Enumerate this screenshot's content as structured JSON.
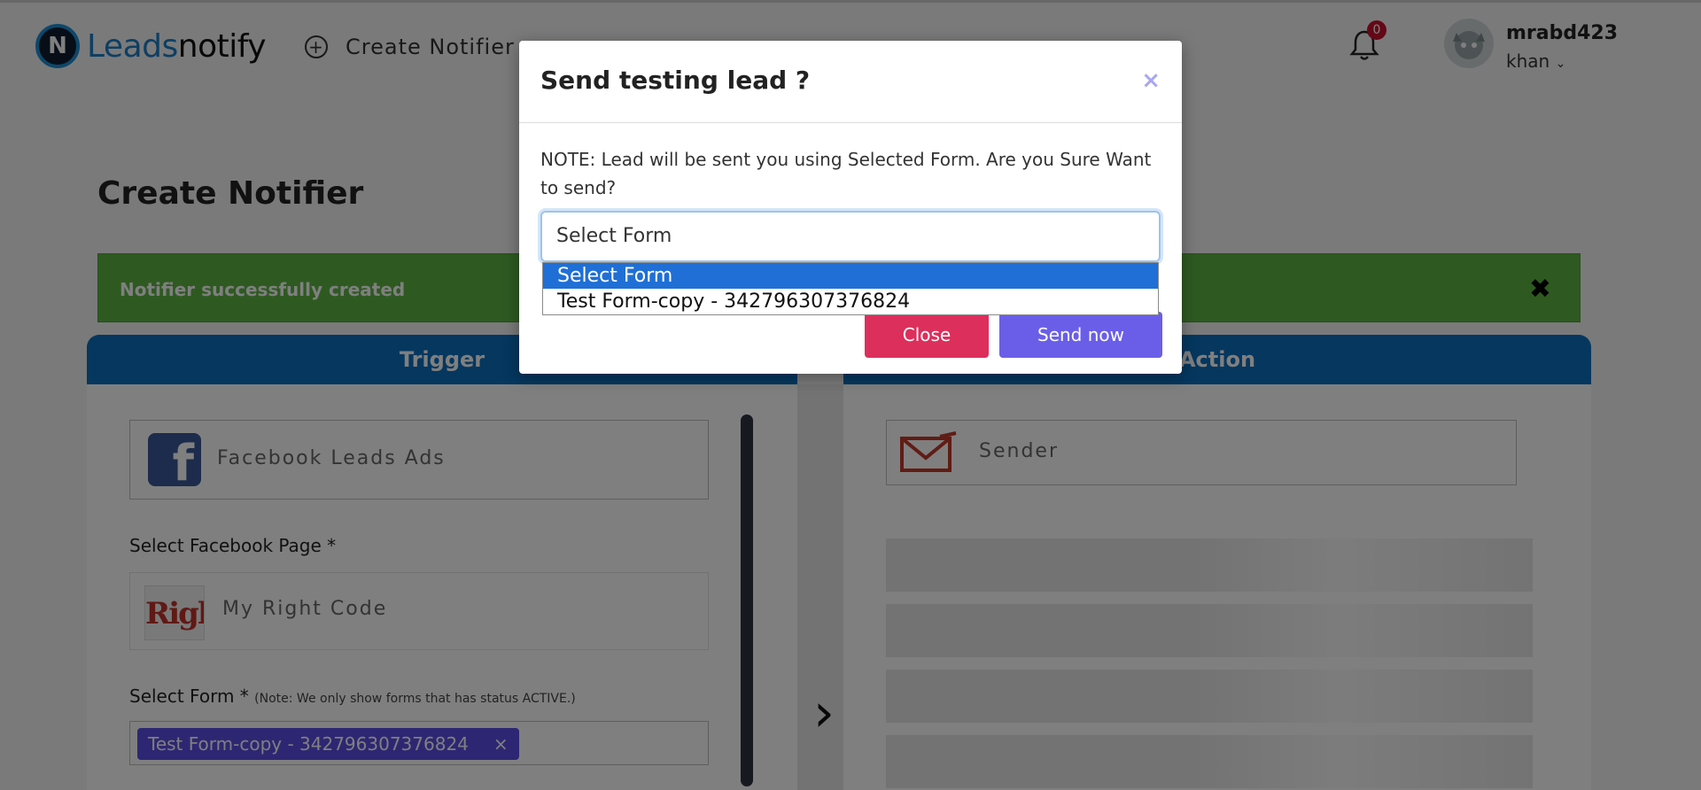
{
  "nav": {
    "logo_leads": "Leads",
    "logo_notify": "notify",
    "create_notifier": "Create Notifier",
    "notification_count": "0",
    "user_name": "mrabd423",
    "user_sub": "khan"
  },
  "page": {
    "title": "Create Notifier",
    "alert_text": "Notifier successfully created",
    "alert_close": "✖",
    "trigger_header": "Trigger",
    "action_header": "Action",
    "trigger_app": "Facebook Leads Ads",
    "select_page_label": "Select Facebook Page *",
    "page_thumb_text": "RightCode",
    "page_name": "My Right Code",
    "select_form_label": "Select Form *",
    "select_form_note": "(Note: We only show forms that has status ACTIVE.)",
    "selected_form_tag": "Test Form-copy - 342796307376824",
    "tag_remove": "×",
    "action_app": "Sender",
    "next_arrow": "›"
  },
  "modal": {
    "title": "Send testing lead ?",
    "close_x": "×",
    "note": "NOTE: Lead will be sent you using Selected Form. Are you Sure Want to send?",
    "select_value": "Select Form",
    "options": [
      "Select Form",
      "Test Form-copy - 342796307376824"
    ],
    "close_label": "Close",
    "send_label": "Send now"
  },
  "colors": {
    "brand_blue": "#0b6fbf",
    "success_green": "#5cb543",
    "close_button": "#dc2f5c",
    "send_button": "#6a5ee9",
    "selected_option": "#1f6fd6"
  },
  "icons": [
    "plus-circle-icon",
    "bell-icon",
    "facebook-icon",
    "mail-icon",
    "chevron-right-icon",
    "close-icon"
  ]
}
